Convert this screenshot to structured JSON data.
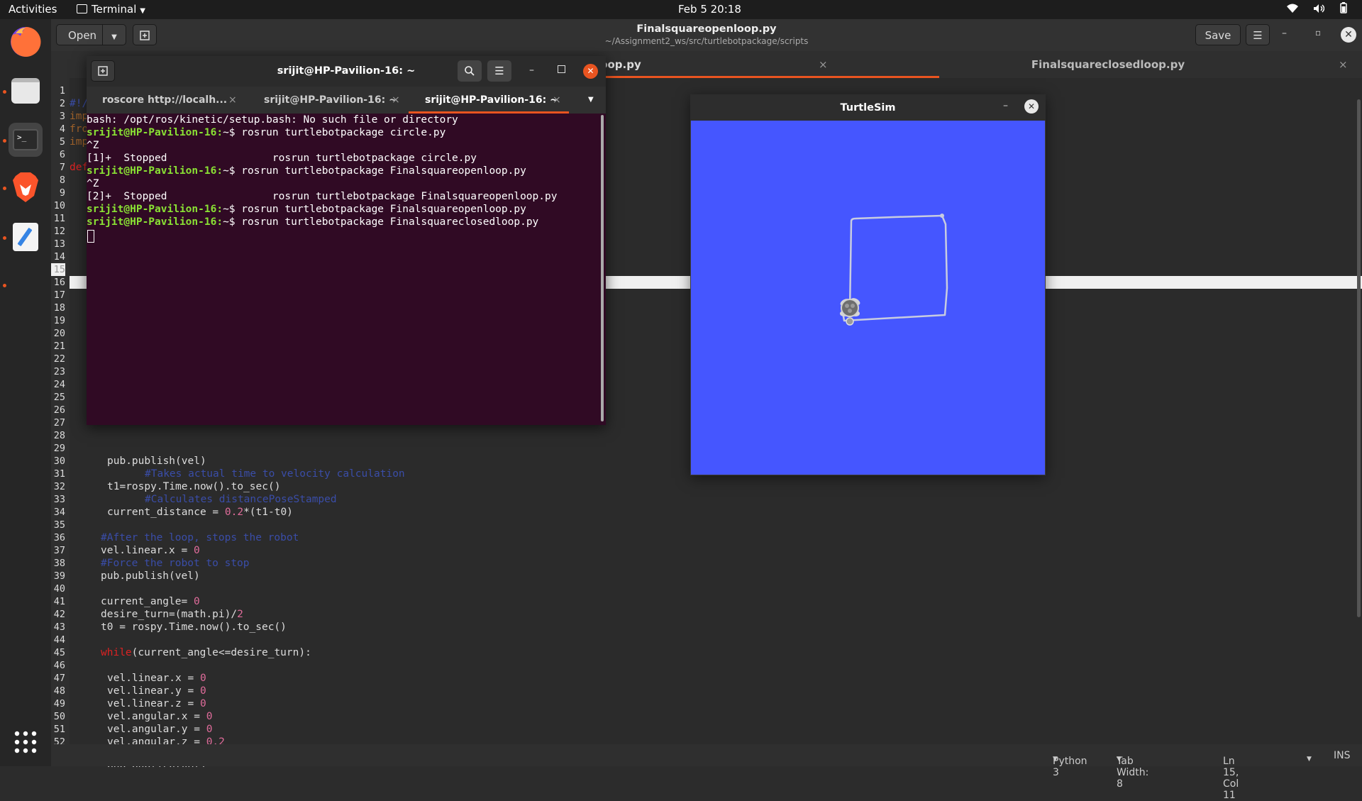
{
  "topbar": {
    "activities": "Activities",
    "app_menu": "Terminal",
    "clock": "Feb 5  20:18"
  },
  "dock": {
    "apps": [
      "Firefox",
      "Files",
      "Terminal",
      "Brave",
      "Text Editor"
    ],
    "show_apps_icon": "grid-icon"
  },
  "gedit": {
    "open_label": "Open",
    "save_label": "Save",
    "title": "Finalsquareopenloop.py",
    "subtitle": "~/Assignment2_ws/src/turtlebotpackage/scripts",
    "tabs": [
      {
        "label": "Finalsquareopenloop.py",
        "visible_label": "inalsquareopenloop.py",
        "active": true
      },
      {
        "label": "Finalsquareclosedloop.py",
        "active": false
      }
    ],
    "line_numbers": [
      "1",
      "2",
      "3",
      "4",
      "5",
      "6",
      "7",
      "8",
      "9",
      "10",
      "11",
      "12",
      "13",
      "14",
      "15",
      "16",
      "17",
      "18",
      "19",
      "20",
      "21",
      "22",
      "23",
      "24",
      "25",
      "26",
      "27",
      "28",
      "29",
      "30",
      "31",
      "32",
      "33",
      "34",
      "35",
      "36",
      "37",
      "38",
      "39",
      "40",
      "41",
      "42",
      "43",
      "44",
      "45",
      "46",
      "47",
      "48",
      "49",
      "50",
      "51",
      "52"
    ],
    "partial_lines": {
      "l1": "#!/",
      "l2": "imp",
      "l3": "fro",
      "l4": "imp",
      "l6": "def"
    },
    "code": {
      "l29": "pub.publish(vel)",
      "l30": "#Takes actual time to velocity calculation",
      "l31": "t1=rospy.Time.now().to_sec()",
      "l32": "#Calculates distancePoseStamped",
      "l33a": "current_distance = ",
      "l33b": "0.2",
      "l33c": "*(t1-t0)",
      "l35": "#After the loop, stops the robot",
      "l36a": "vel.linear.x = ",
      "l36b": "0",
      "l37": "#Force the robot to stop",
      "l38": "pub.publish(vel)",
      "l40a": "current_angle= ",
      "l40b": "0",
      "l41a": "desire_turn=(math.pi)/",
      "l41b": "2",
      "l42": "t0 = rospy.Time.now().to_sec()",
      "l44a": "while",
      "l44b": "(current_angle<=desire_turn):",
      "l46a": "vel.linear.x = ",
      "l46b": "0",
      "l47a": "vel.linear.y = ",
      "l47b": "0",
      "l48a": "vel.linear.z = ",
      "l48b": "0",
      "l49a": "vel.angular.x = ",
      "l49b": "0",
      "l50a": "vel.angular.y = ",
      "l50b": "0",
      "l51a": "vel.angular.z = ",
      "l51b": "0.2",
      "l53": "pub.publish(vel)"
    },
    "status": {
      "language": "Python 3",
      "tab_width": "Tab Width: 8",
      "position": "Ln 15, Col 11",
      "mode": "INS"
    }
  },
  "terminal": {
    "title": "srijit@HP-Pavilion-16: ~",
    "tabs": [
      {
        "label": "roscore http://localh...",
        "active": false
      },
      {
        "label": "srijit@HP-Pavilion-16: ~",
        "active": false
      },
      {
        "label": "srijit@HP-Pavilion-16: ~",
        "active": true
      }
    ],
    "prompt": "srijit@HP-Pavilion-16:",
    "lines": [
      {
        "type": "out",
        "text": "bash: /opt/ros/kinetic/setup.bash: No such file or directory"
      },
      {
        "type": "cmd",
        "text": "~$ rosrun turtlebotpackage circle.py"
      },
      {
        "type": "out",
        "text": "^Z"
      },
      {
        "type": "out",
        "text": "[1]+  Stopped                 rosrun turtlebotpackage circle.py"
      },
      {
        "type": "cmd",
        "text": "~$ rosrun turtlebotpackage Finalsquareopenloop.py"
      },
      {
        "type": "out",
        "text": "^Z"
      },
      {
        "type": "out",
        "text": "[2]+  Stopped                 rosrun turtlebotpackage Finalsquareopenloop.py"
      },
      {
        "type": "cmd",
        "text": "~$ rosrun turtlebotpackage Finalsquareopenloop.py"
      },
      {
        "type": "cmd",
        "text": "~$ rosrun turtlebotpackage Finalsquareclosedloop.py"
      }
    ]
  },
  "turtlesim": {
    "title": "TurtleSim",
    "background": "#4556ff",
    "path_color": "#c8cce0"
  }
}
